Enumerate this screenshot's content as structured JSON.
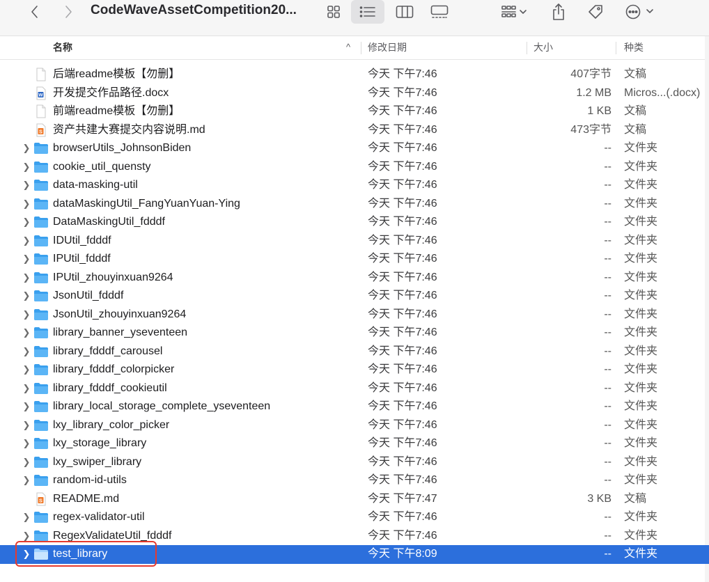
{
  "toolbar": {
    "title": "CodeWaveAssetCompetition20...",
    "icons": [
      "chevron-left-icon",
      "chevron-right-icon",
      "grid-view-icon",
      "list-view-icon",
      "column-view-icon",
      "gallery-view-icon",
      "group-icon",
      "share-icon",
      "tag-icon",
      "more-icon"
    ]
  },
  "header": {
    "name": "名称",
    "date": "修改日期",
    "size": "大小",
    "kind": "种类",
    "sort_indicator": "^"
  },
  "files": [
    {
      "name": "后端readme模板【勿删】",
      "date": "今天 下午7:46",
      "size": "407字节",
      "kind": "文稿",
      "type": "doc",
      "folder": false,
      "selected": false
    },
    {
      "name": "开发提交作品路径.docx",
      "date": "今天 下午7:46",
      "size": "1.2 MB",
      "kind": "Micros...(.docx)",
      "type": "word",
      "folder": false,
      "selected": false
    },
    {
      "name": "前端readme模板【勿删】",
      "date": "今天 下午7:46",
      "size": "1 KB",
      "kind": "文稿",
      "type": "doc",
      "folder": false,
      "selected": false
    },
    {
      "name": "资产共建大赛提交内容说明.md",
      "date": "今天 下午7:46",
      "size": "473字节",
      "kind": "文稿",
      "type": "md",
      "folder": false,
      "selected": false
    },
    {
      "name": "browserUtils_JohnsonBiden",
      "date": "今天 下午7:46",
      "size": "--",
      "kind": "文件夹",
      "type": "folder",
      "folder": true,
      "selected": false
    },
    {
      "name": "cookie_util_quensty",
      "date": "今天 下午7:46",
      "size": "--",
      "kind": "文件夹",
      "type": "folder",
      "folder": true,
      "selected": false
    },
    {
      "name": "data-masking-util",
      "date": "今天 下午7:46",
      "size": "--",
      "kind": "文件夹",
      "type": "folder",
      "folder": true,
      "selected": false
    },
    {
      "name": "dataMaskingUtil_FangYuanYuan-Ying",
      "date": "今天 下午7:46",
      "size": "--",
      "kind": "文件夹",
      "type": "folder",
      "folder": true,
      "selected": false
    },
    {
      "name": "DataMaskingUtil_fdddf",
      "date": "今天 下午7:46",
      "size": "--",
      "kind": "文件夹",
      "type": "folder",
      "folder": true,
      "selected": false
    },
    {
      "name": "IDUtil_fdddf",
      "date": "今天 下午7:46",
      "size": "--",
      "kind": "文件夹",
      "type": "folder",
      "folder": true,
      "selected": false
    },
    {
      "name": "IPUtil_fdddf",
      "date": "今天 下午7:46",
      "size": "--",
      "kind": "文件夹",
      "type": "folder",
      "folder": true,
      "selected": false
    },
    {
      "name": "IPUtil_zhouyinxuan9264",
      "date": "今天 下午7:46",
      "size": "--",
      "kind": "文件夹",
      "type": "folder",
      "folder": true,
      "selected": false
    },
    {
      "name": "JsonUtil_fdddf",
      "date": "今天 下午7:46",
      "size": "--",
      "kind": "文件夹",
      "type": "folder",
      "folder": true,
      "selected": false
    },
    {
      "name": "JsonUtil_zhouyinxuan9264",
      "date": "今天 下午7:46",
      "size": "--",
      "kind": "文件夹",
      "type": "folder",
      "folder": true,
      "selected": false
    },
    {
      "name": "library_banner_yseventeen",
      "date": "今天 下午7:46",
      "size": "--",
      "kind": "文件夹",
      "type": "folder",
      "folder": true,
      "selected": false
    },
    {
      "name": "library_fdddf_carousel",
      "date": "今天 下午7:46",
      "size": "--",
      "kind": "文件夹",
      "type": "folder",
      "folder": true,
      "selected": false
    },
    {
      "name": "library_fdddf_colorpicker",
      "date": "今天 下午7:46",
      "size": "--",
      "kind": "文件夹",
      "type": "folder",
      "folder": true,
      "selected": false
    },
    {
      "name": "library_fdddf_cookieutil",
      "date": "今天 下午7:46",
      "size": "--",
      "kind": "文件夹",
      "type": "folder",
      "folder": true,
      "selected": false
    },
    {
      "name": "library_local_storage_complete_yseventeen",
      "date": "今天 下午7:46",
      "size": "--",
      "kind": "文件夹",
      "type": "folder",
      "folder": true,
      "selected": false
    },
    {
      "name": "lxy_library_color_picker",
      "date": "今天 下午7:46",
      "size": "--",
      "kind": "文件夹",
      "type": "folder",
      "folder": true,
      "selected": false
    },
    {
      "name": "lxy_storage_library",
      "date": "今天 下午7:46",
      "size": "--",
      "kind": "文件夹",
      "type": "folder",
      "folder": true,
      "selected": false
    },
    {
      "name": "lxy_swiper_library",
      "date": "今天 下午7:46",
      "size": "--",
      "kind": "文件夹",
      "type": "folder",
      "folder": true,
      "selected": false
    },
    {
      "name": "random-id-utils",
      "date": "今天 下午7:46",
      "size": "--",
      "kind": "文件夹",
      "type": "folder",
      "folder": true,
      "selected": false
    },
    {
      "name": "README.md",
      "date": "今天 下午7:47",
      "size": "3 KB",
      "kind": "文稿",
      "type": "md",
      "folder": false,
      "selected": false
    },
    {
      "name": "regex-validator-util",
      "date": "今天 下午7:46",
      "size": "--",
      "kind": "文件夹",
      "type": "folder",
      "folder": true,
      "selected": false
    },
    {
      "name": "RegexValidateUtil_fdddf",
      "date": "今天 下午7:46",
      "size": "--",
      "kind": "文件夹",
      "type": "folder",
      "folder": true,
      "selected": false
    },
    {
      "name": "test_library",
      "date": "今天 下午8:09",
      "size": "--",
      "kind": "文件夹",
      "type": "folder",
      "folder": true,
      "selected": true
    }
  ],
  "colors": {
    "selection": "#2c6fdc",
    "highlight_outline": "#e63a2e",
    "folder": "#3aa0ee"
  }
}
